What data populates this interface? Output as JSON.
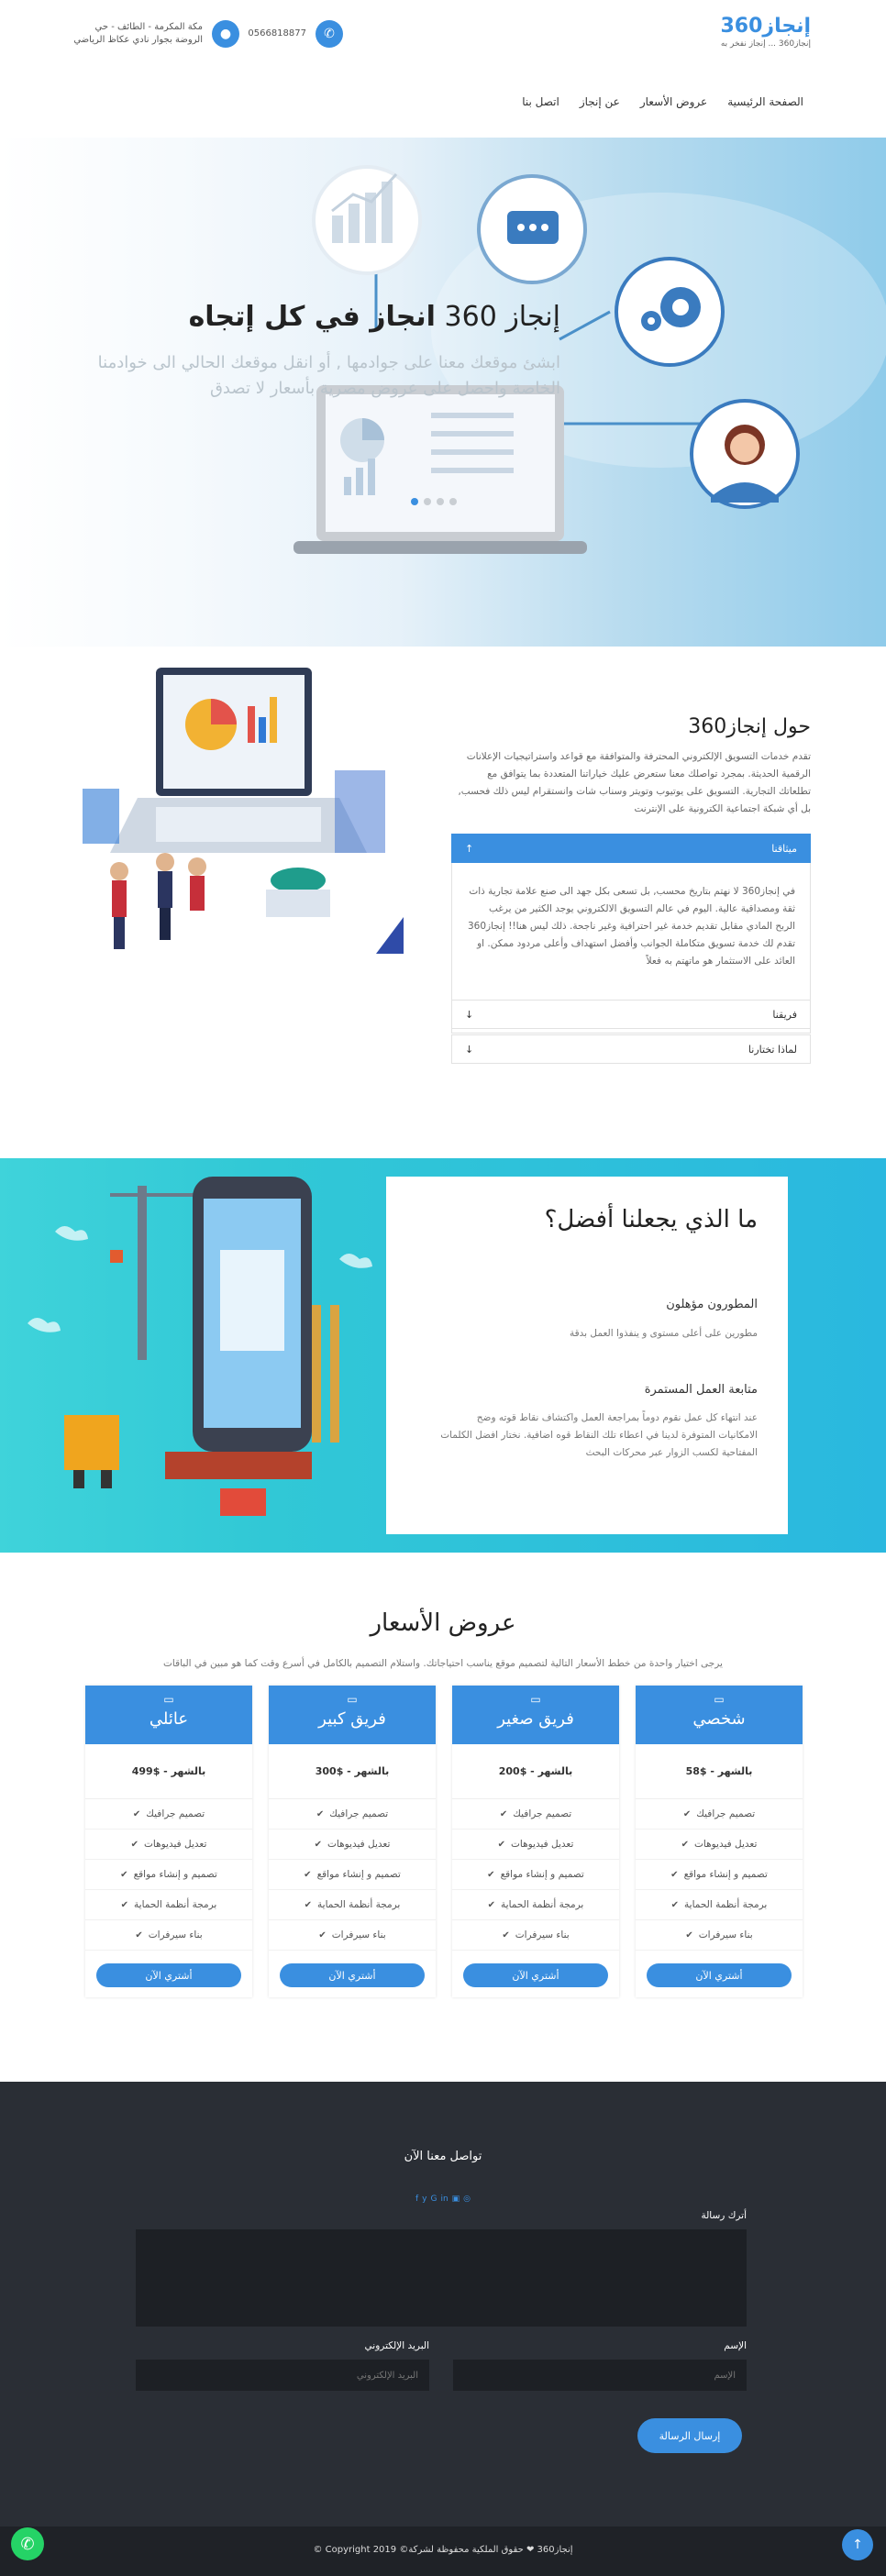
{
  "header": {
    "logo_main": "إنجاز360",
    "logo_sub": "إنجاز360 ... إنجاز نفخر به",
    "phone": "0566818877",
    "address_line1": "مكة المكرمة - الطائف - حي",
    "address_line2": "الروضة بجوار نادي عكاظ الرياضي",
    "phone_icon": "phone-icon",
    "location_icon": "map-pin-icon",
    "nav": [
      "الصفحة الرئيسية",
      "عروض الأسعار",
      "عن إنجاز",
      "اتصل بنا"
    ]
  },
  "hero": {
    "title_a": "إنجاز 360",
    "title_b": "انجاز في كل إتجاه",
    "subtitle": "ابشئ موقعك معنا على جوادمها , أو انقل موقعك الحالي الى خوادمنا الخاصة واحصل على عروض مصرية بأسعار لا تصدق",
    "slides": 4,
    "active_slide": 4
  },
  "about": {
    "title": "حول إنجاز360",
    "text": "تقدم خدمات التسويق الإلكتروني المحترفة والمتوافقة مع قواعد واستراتيجيات الإعلانات الرقمية الحديثة. بمجرد تواصلك معنا ستعرض عليك خياراتنا المتعددة بما يتوافق مع تطلعاتك التجارية. التسويق على يوتيوب وتويتر وسناب شات وانستقرام ليس ذلك فحسب, بل أي شبكة اجتماعية الكترونية على الإنترنت",
    "accordion": [
      {
        "label": "ميثاقنا",
        "arrow": "↑",
        "body": "في إنجاز360 لا نهتم بتاريخ محسب, بل تسعى بكل جهد الى صنع علامة تجارية ذات ثقة ومصداقية عالية. اليوم في عالم التسويق الالكتروني يوجد الكثير من يرغب الربح المادي مقابل تقديم خدمة غير احترافية وغير ناجحة. ذلك ليس هنا!! إنجاز360 تقدم لك خدمة تسويق متكاملة الجوانب وأفضل استهداف وأعلى مردود ممكن. او العائد على الاستثمار هو ماتهتم به فعلاً"
      },
      {
        "label": "فريقنا",
        "arrow": "↓"
      },
      {
        "label": "لماذا تختارنا",
        "arrow": "↓"
      }
    ]
  },
  "why": {
    "title": "ما الذي يجعلنا أفضل؟",
    "items": [
      {
        "heading": "المطورون مؤهلون",
        "text": "مطورين على أعلى مستوى و ينفذوا العمل بدقة"
      },
      {
        "heading": "متابعة العمل المستمرة",
        "text": "عند انتهاء كل عمل نقوم دوماً بمراجعة العمل واكتشاف نقاط قوته وضح الامكانيات المتوفرة لدينا في اعطاء تلك النقاط قوه اضافية. نختار افضل الكلمات المفتاحية لكسب الزوار عبر محركات البحث"
      }
    ]
  },
  "pricing": {
    "title": "عروض الأسعار",
    "subtitle": "يرجى اختيار واحدة من خطط الأسعار التالية لتصميم موقع يناسب احتياجاتك. واستلام التصميم بالكامل في أسرع وقت كما هو مبين في الباقات",
    "plan_icon": "monitor-icon",
    "check_icon": "check-icon",
    "plans": [
      {
        "name": "شخصي",
        "price": "بالشهر - $58",
        "features": [
          "تصميم جرافيك",
          "تعديل فيديوهات",
          "تصميم و إنشاء مواقع",
          "برمجة أنظمة الحماية",
          "بناء سيرفرات"
        ],
        "button": "أشتري الآن"
      },
      {
        "name": "فريق صغير",
        "price": "بالشهر - $200",
        "features": [
          "تصميم جرافيك",
          "تعديل فيديوهات",
          "تصميم و إنشاء مواقع",
          "برمجة أنظمة الحماية",
          "بناء سيرفرات"
        ],
        "button": "أشتري الآن"
      },
      {
        "name": "فريق كبير",
        "price": "بالشهر - $300",
        "features": [
          "تصميم جرافيك",
          "تعديل فيديوهات",
          "تصميم و إنشاء مواقع",
          "برمجة أنظمة الحماية",
          "بناء سيرفرات"
        ],
        "button": "أشتري الآن"
      },
      {
        "name": "عائلي",
        "price": "بالشهر - $499",
        "features": [
          "تصميم جرافيك",
          "تعديل فيديوهات",
          "تصميم و إنشاء مواقع",
          "برمجة أنظمة الحماية",
          "بناء سيرفرات"
        ],
        "button": "أشتري الآن"
      }
    ]
  },
  "footer": {
    "title": "تواصل معنا الآن",
    "social": [
      "f",
      "y",
      "G",
      "in",
      "▣",
      "◎"
    ],
    "message_label": "أترك رسالة",
    "name_label": "الإسم",
    "name_placeholder": "الإسم",
    "email_label": "البريد الإلكتروني",
    "email_placeholder": "البريد الإلكتروني",
    "send": "إرسال الرسالة",
    "copyright": "إنجاز360 ❤ حقوق الملكية محفوظة لشركة© 2019 Copyright ©",
    "whatsapp_icon": "whatsapp-icon",
    "top_icon": "arrow-up-icon"
  },
  "colors": {
    "accent": "#3a8fe0",
    "footer": "#2a2e35",
    "why_bg": "#31c8d6"
  }
}
